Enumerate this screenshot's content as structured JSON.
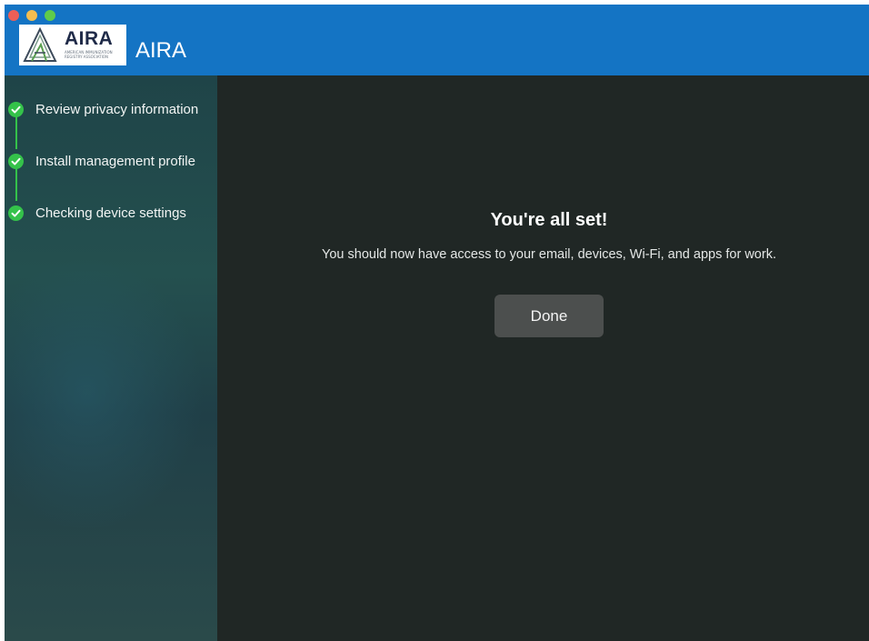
{
  "window": {
    "controls": [
      "close",
      "minimize",
      "maximize"
    ]
  },
  "header": {
    "logo_text": "AIRA",
    "logo_subtext": "American Immunization Registry Association",
    "app_title": "AIRA",
    "background_color": "#1474c4"
  },
  "sidebar": {
    "steps": [
      {
        "label": "Review privacy information",
        "status": "complete",
        "icon": "check-circle-icon"
      },
      {
        "label": "Install management profile",
        "status": "complete",
        "icon": "check-circle-icon"
      },
      {
        "label": "Checking device settings",
        "status": "complete",
        "icon": "check-circle-icon"
      }
    ],
    "accent_color": "#34c24a"
  },
  "main": {
    "heading": "You're all set!",
    "message": "You should now have access to your email, devices, Wi-Fi, and apps for work.",
    "done_label": "Done"
  }
}
